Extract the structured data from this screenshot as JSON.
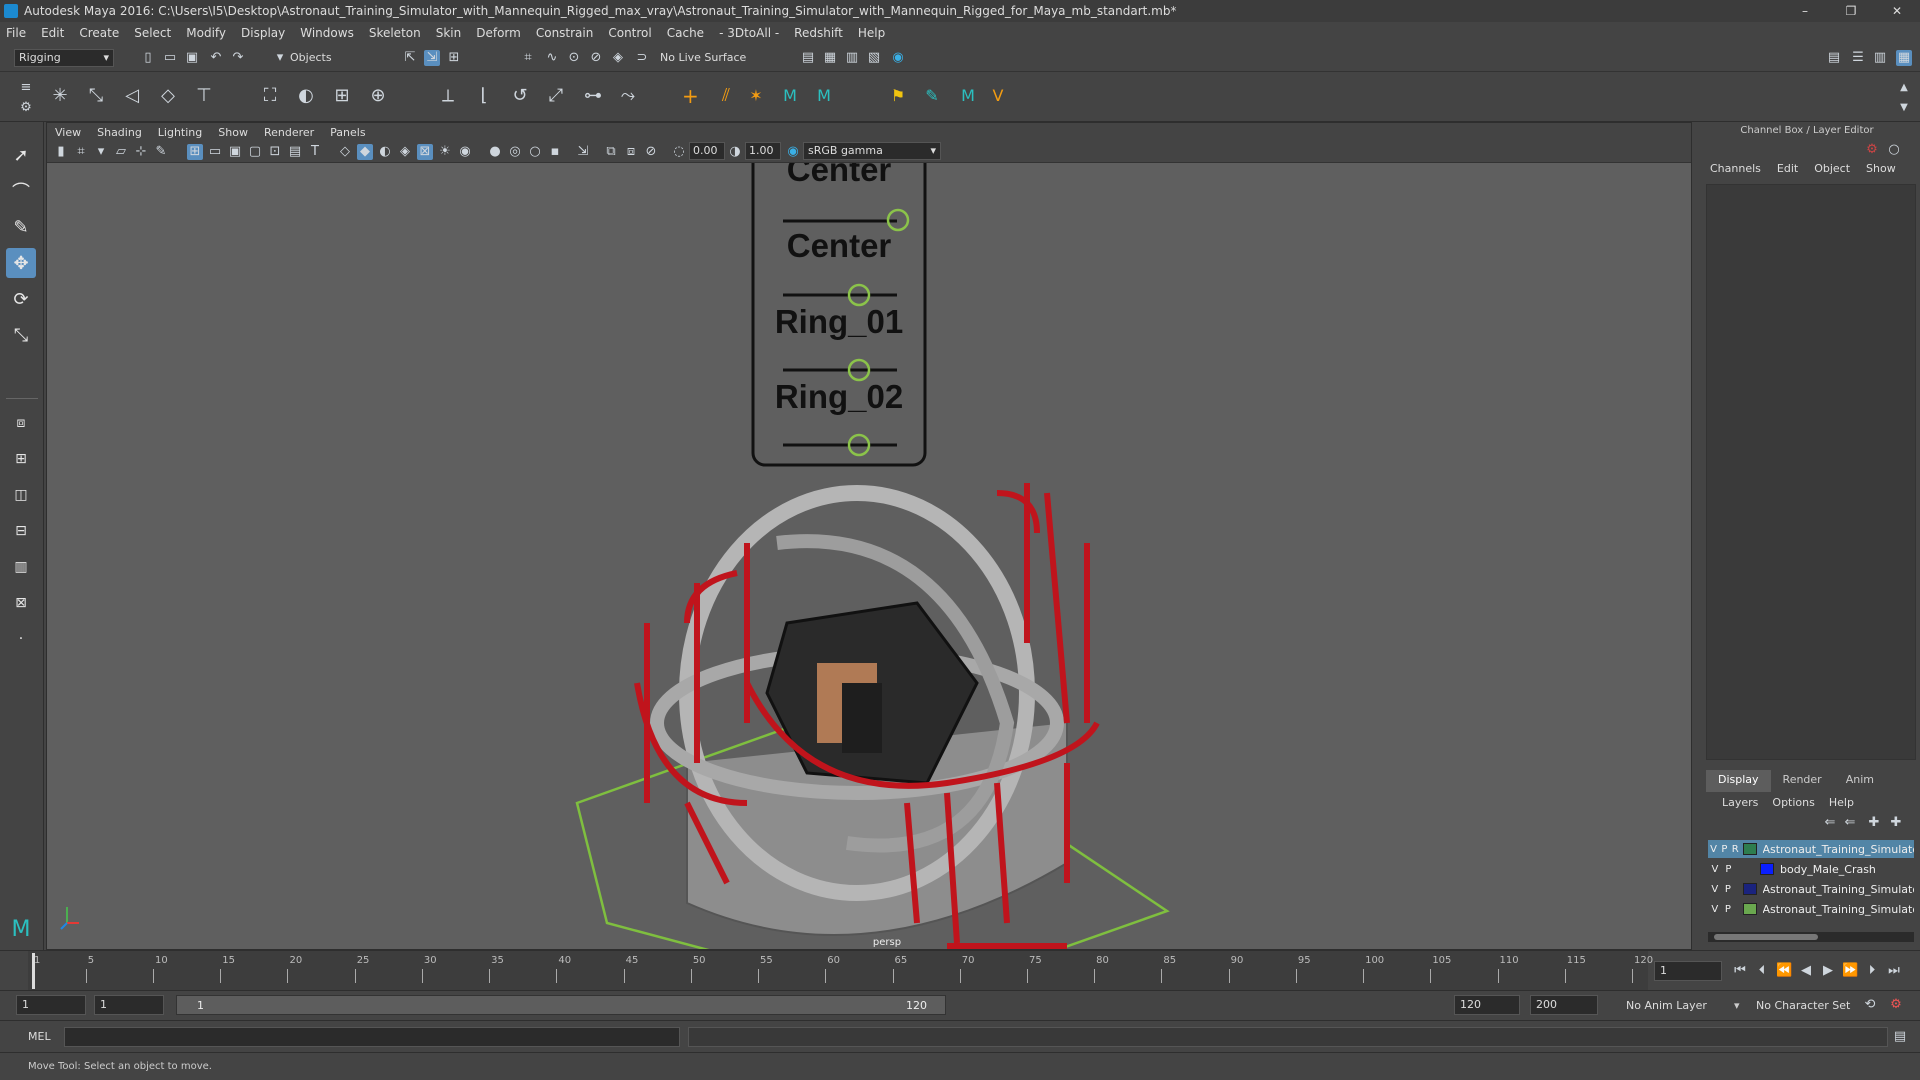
{
  "window": {
    "title": "Autodesk Maya 2016: C:\\Users\\I5\\Desktop\\Astronaut_Training_Simulator_with_Mannequin_Rigged_max_vray\\Astronaut_Training_Simulator_with_Mannequin_Rigged_for_Maya_mb_standart.mb*",
    "min": "–",
    "max": "❐",
    "close": "✕"
  },
  "menu": [
    "File",
    "Edit",
    "Create",
    "Select",
    "Modify",
    "Display",
    "Windows",
    "Skeleton",
    "Skin",
    "Deform",
    "Constrain",
    "Control",
    "Cache",
    "- 3DtoAll -",
    "Redshift",
    "Help"
  ],
  "status": {
    "menuset": "Rigging",
    "selmode": "Objects",
    "live_surface": "No Live Surface"
  },
  "panel": {
    "menu": [
      "View",
      "Shading",
      "Lighting",
      "Show",
      "Renderer",
      "Panels"
    ],
    "exposure": "0.00",
    "gamma": "1.00",
    "colorspace": "sRGB gamma",
    "camera": "persp"
  },
  "controls": {
    "labels": [
      "Center",
      "Center",
      "Ring_01",
      "Ring_02"
    ]
  },
  "channel_box": {
    "title": "Channel Box / Layer Editor",
    "menu": [
      "Channels",
      "Edit",
      "Object",
      "Show"
    ]
  },
  "layer_editor": {
    "tabs": [
      "Display",
      "Render",
      "Anim"
    ],
    "menu": [
      "Layers",
      "Options",
      "Help"
    ],
    "layers": [
      {
        "v": "V",
        "p": "P",
        "r": "R",
        "name": "Astronaut_Training_Simulato",
        "color": "#2e7d4f",
        "selected": true
      },
      {
        "v": "V",
        "p": "P",
        "r": "",
        "name": "body_Male_Crash",
        "color": "#0a1fff",
        "selected": false
      },
      {
        "v": "V",
        "p": "P",
        "r": "",
        "name": "Astronaut_Training_Simulato",
        "color": "#1a237e",
        "selected": false
      },
      {
        "v": "V",
        "p": "P",
        "r": "",
        "name": "Astronaut_Training_Simulato",
        "color": "#6aa84f",
        "selected": false
      }
    ]
  },
  "timeline": {
    "ticks": [
      "1",
      "5",
      "10",
      "15",
      "20",
      "25",
      "30",
      "35",
      "40",
      "45",
      "50",
      "55",
      "60",
      "65",
      "70",
      "75",
      "80",
      "85",
      "90",
      "95",
      "100",
      "105",
      "110",
      "115",
      "120"
    ],
    "current_frame": "1"
  },
  "range": {
    "start": "1",
    "playback_start": "1",
    "slider_start": "1",
    "slider_end": "120",
    "playback_end": "120",
    "end": "200",
    "anim_layer": "No Anim Layer",
    "character_set": "No Character Set"
  },
  "command": {
    "lang": "MEL"
  },
  "help": {
    "text": "Move Tool: Select an object to move."
  }
}
